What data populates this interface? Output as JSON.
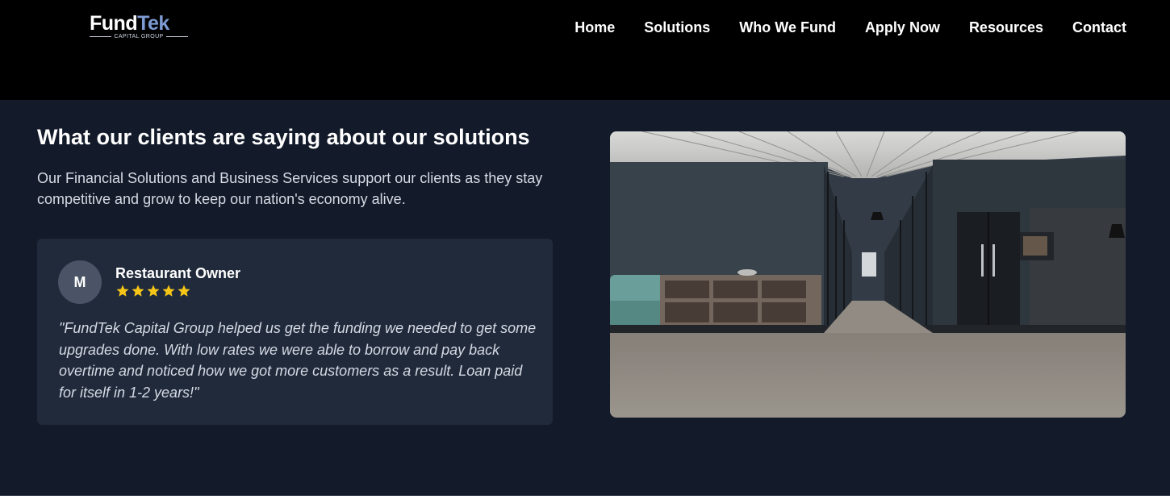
{
  "brand": {
    "name_part1": "Fund",
    "name_part2": "Tek",
    "tagline": "CAPITAL GROUP"
  },
  "nav": {
    "items": [
      {
        "label": "Home"
      },
      {
        "label": "Solutions"
      },
      {
        "label": "Who We Fund"
      },
      {
        "label": "Apply Now"
      },
      {
        "label": "Resources"
      },
      {
        "label": "Contact"
      }
    ]
  },
  "testimonials": {
    "heading": "What our clients are saying about our solutions",
    "intro": "Our Financial Solutions and Business Services support our clients as they stay competitive and grow to keep our nation's economy alive.",
    "review": {
      "avatar_initial": "M",
      "reviewer": "Restaurant Owner",
      "rating": 5,
      "rating_max": 5,
      "quote": "\"FundTek Capital Group helped us get the funding we needed to get some upgrades done. With low rates we were able to borrow and pay back overtime and noticed how we got more customers as a result. Loan paid for itself in 1-2 years!\""
    }
  },
  "colors": {
    "header_bg": "#000000",
    "section_bg": "#131a2a",
    "card_bg": "#202a3b",
    "star": "#f5c518",
    "brand_accent": "#7d9bd3"
  }
}
